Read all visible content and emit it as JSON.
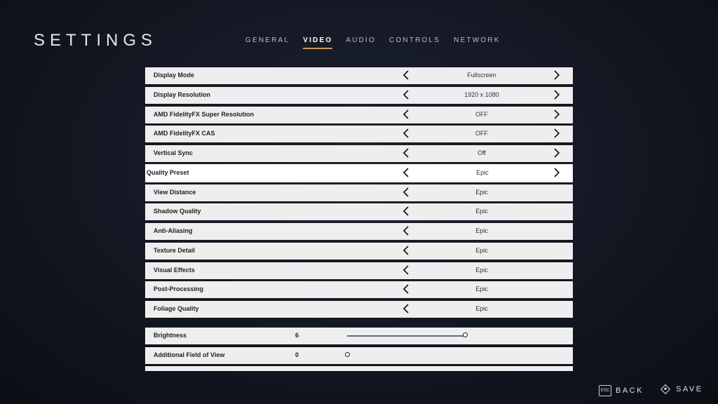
{
  "header": {
    "title": "SETTINGS"
  },
  "tabs": [
    {
      "label": "GENERAL",
      "active": false
    },
    {
      "label": "VIDEO",
      "active": true
    },
    {
      "label": "AUDIO",
      "active": false
    },
    {
      "label": "CONTROLS",
      "active": false
    },
    {
      "label": "NETWORK",
      "active": false
    }
  ],
  "settings": [
    {
      "label": "Display Mode",
      "value": "Fullscreen",
      "right_arrow": true
    },
    {
      "label": "Display Resolution",
      "value": "1920 x 1080",
      "right_arrow": true
    },
    {
      "label": "AMD FidelityFX Super Resolution",
      "value": "OFF",
      "right_arrow": true
    },
    {
      "label": "AMD FidelityFX CAS",
      "value": "OFF",
      "right_arrow": true
    },
    {
      "label": "Vertical Sync",
      "value": "Off",
      "right_arrow": true
    },
    {
      "label": "Quality Preset",
      "value": "Epic",
      "right_arrow": true,
      "selected": true
    },
    {
      "label": "View Distance",
      "value": "Epic",
      "right_arrow": false
    },
    {
      "label": "Shadow Quality",
      "value": "Epic",
      "right_arrow": false
    },
    {
      "label": "Anti-Aliasing",
      "value": "Epic",
      "right_arrow": false
    },
    {
      "label": "Texture Detail",
      "value": "Epic",
      "right_arrow": false
    },
    {
      "label": "Visual Effects",
      "value": "Epic",
      "right_arrow": false
    },
    {
      "label": "Post-Processing",
      "value": "Epic",
      "right_arrow": false
    },
    {
      "label": "Foliage Quality",
      "value": "Epic",
      "right_arrow": false
    }
  ],
  "sliders": [
    {
      "label": "Brightness",
      "value": "6",
      "fraction": 1.0,
      "track": true
    },
    {
      "label": "Additional Field of View",
      "value": "0",
      "fraction": 0.0,
      "track": false
    }
  ],
  "footer": {
    "back_key": "ESC",
    "back_label": "BACK",
    "save_label": "SAVE"
  },
  "icons": {
    "left_arrow": "chevron-left-icon",
    "right_arrow": "chevron-right-icon",
    "save": "diamond-icon"
  },
  "colors": {
    "accent": "#f08c2a",
    "row_bg": "#eeeeee",
    "slider": "#5a6b8a"
  }
}
